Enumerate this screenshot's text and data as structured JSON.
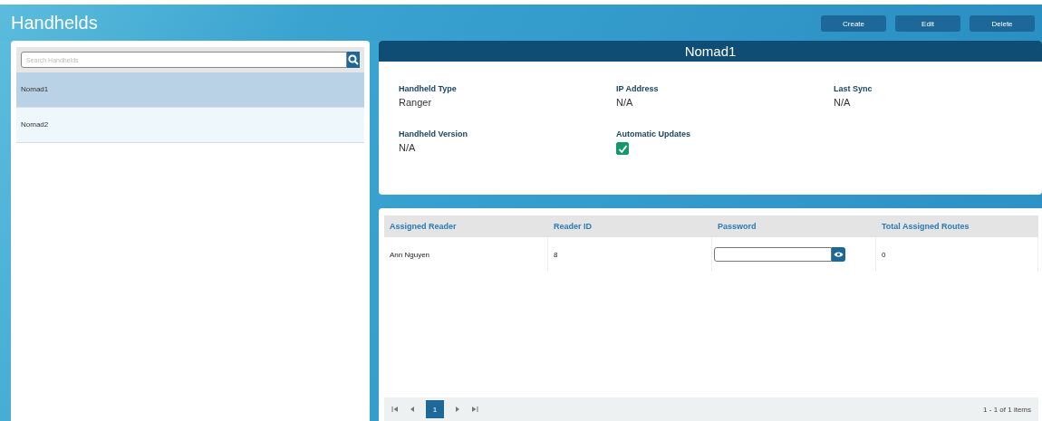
{
  "page": {
    "title": "Handhelds"
  },
  "actions": [
    "Create",
    "Edit",
    "Delete"
  ],
  "search": {
    "placeholder": "Search Handhelds"
  },
  "handhelds": [
    {
      "name": "Nomad1",
      "selected": true
    },
    {
      "name": "Nomad2",
      "selected": false
    }
  ],
  "detail": {
    "title": "Nomad1",
    "fields": [
      {
        "kind": "text",
        "label": "Handheld Type",
        "value": "Ranger"
      },
      {
        "kind": "text",
        "label": "IP Address",
        "value": "N/A"
      },
      {
        "kind": "text",
        "label": "Last Sync",
        "value": "N/A"
      },
      {
        "kind": "text",
        "label": "Handheld Version",
        "value": "N/A"
      },
      {
        "kind": "checkbox",
        "label": "Automatic Updates",
        "checked": true
      }
    ]
  },
  "table": {
    "columns": [
      "Assigned Reader",
      "Reader ID",
      "Password",
      "Total Assigned Routes"
    ],
    "rows": [
      {
        "reader": "Ann Nguyen",
        "reader_id": "8",
        "routes": "0"
      }
    ]
  },
  "pager": {
    "pages": [
      {
        "label": "1",
        "selected": true
      }
    ],
    "summary": "1 - 1 of 1 items"
  }
}
